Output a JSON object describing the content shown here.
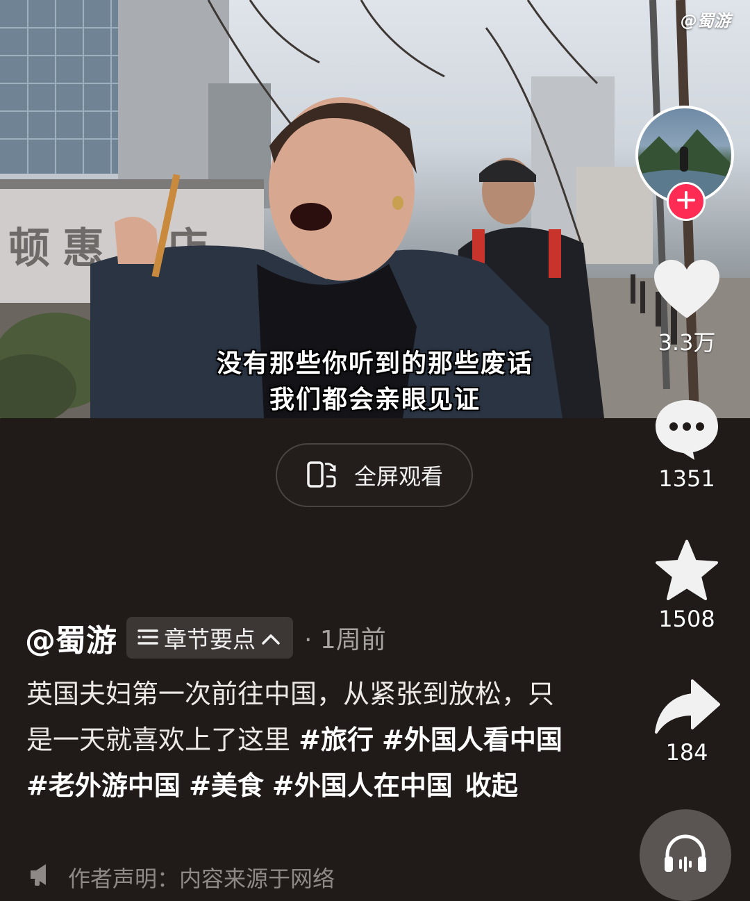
{
  "watermark": "@蜀游",
  "subtitles": {
    "line1": "没有那些你听到的那些废话",
    "line2": "我们都会亲眼见证"
  },
  "fullscreen_label": "全屏观看",
  "actions": {
    "likes": "3.3万",
    "comments": "1351",
    "favorites": "1508",
    "shares": "184"
  },
  "post": {
    "author": "@蜀游",
    "chapters_label": "章节要点",
    "time_ago": "· 1周前",
    "description_text": "英国夫妇第一次前往中国，从紧张到放松，只是一天就喜欢上了这里",
    "hashtags": [
      "#旅行",
      "#外国人看中国",
      "#老外游中国",
      "#美食",
      "#外国人在中国"
    ],
    "collapse_label": "收起",
    "notice": "作者声明：内容来源于网络"
  },
  "colors": {
    "background": "#201b19",
    "follow_badge": "#fe2c55",
    "chip_bg": "#3c3735",
    "muted_text": "#a6a2a0"
  },
  "icons": [
    "chevron-up-icon",
    "list-icon",
    "heart-icon",
    "comment-icon",
    "star-icon",
    "share-icon",
    "headphones-icon",
    "megaphone-icon",
    "rotate-screen-icon",
    "plus-icon"
  ]
}
